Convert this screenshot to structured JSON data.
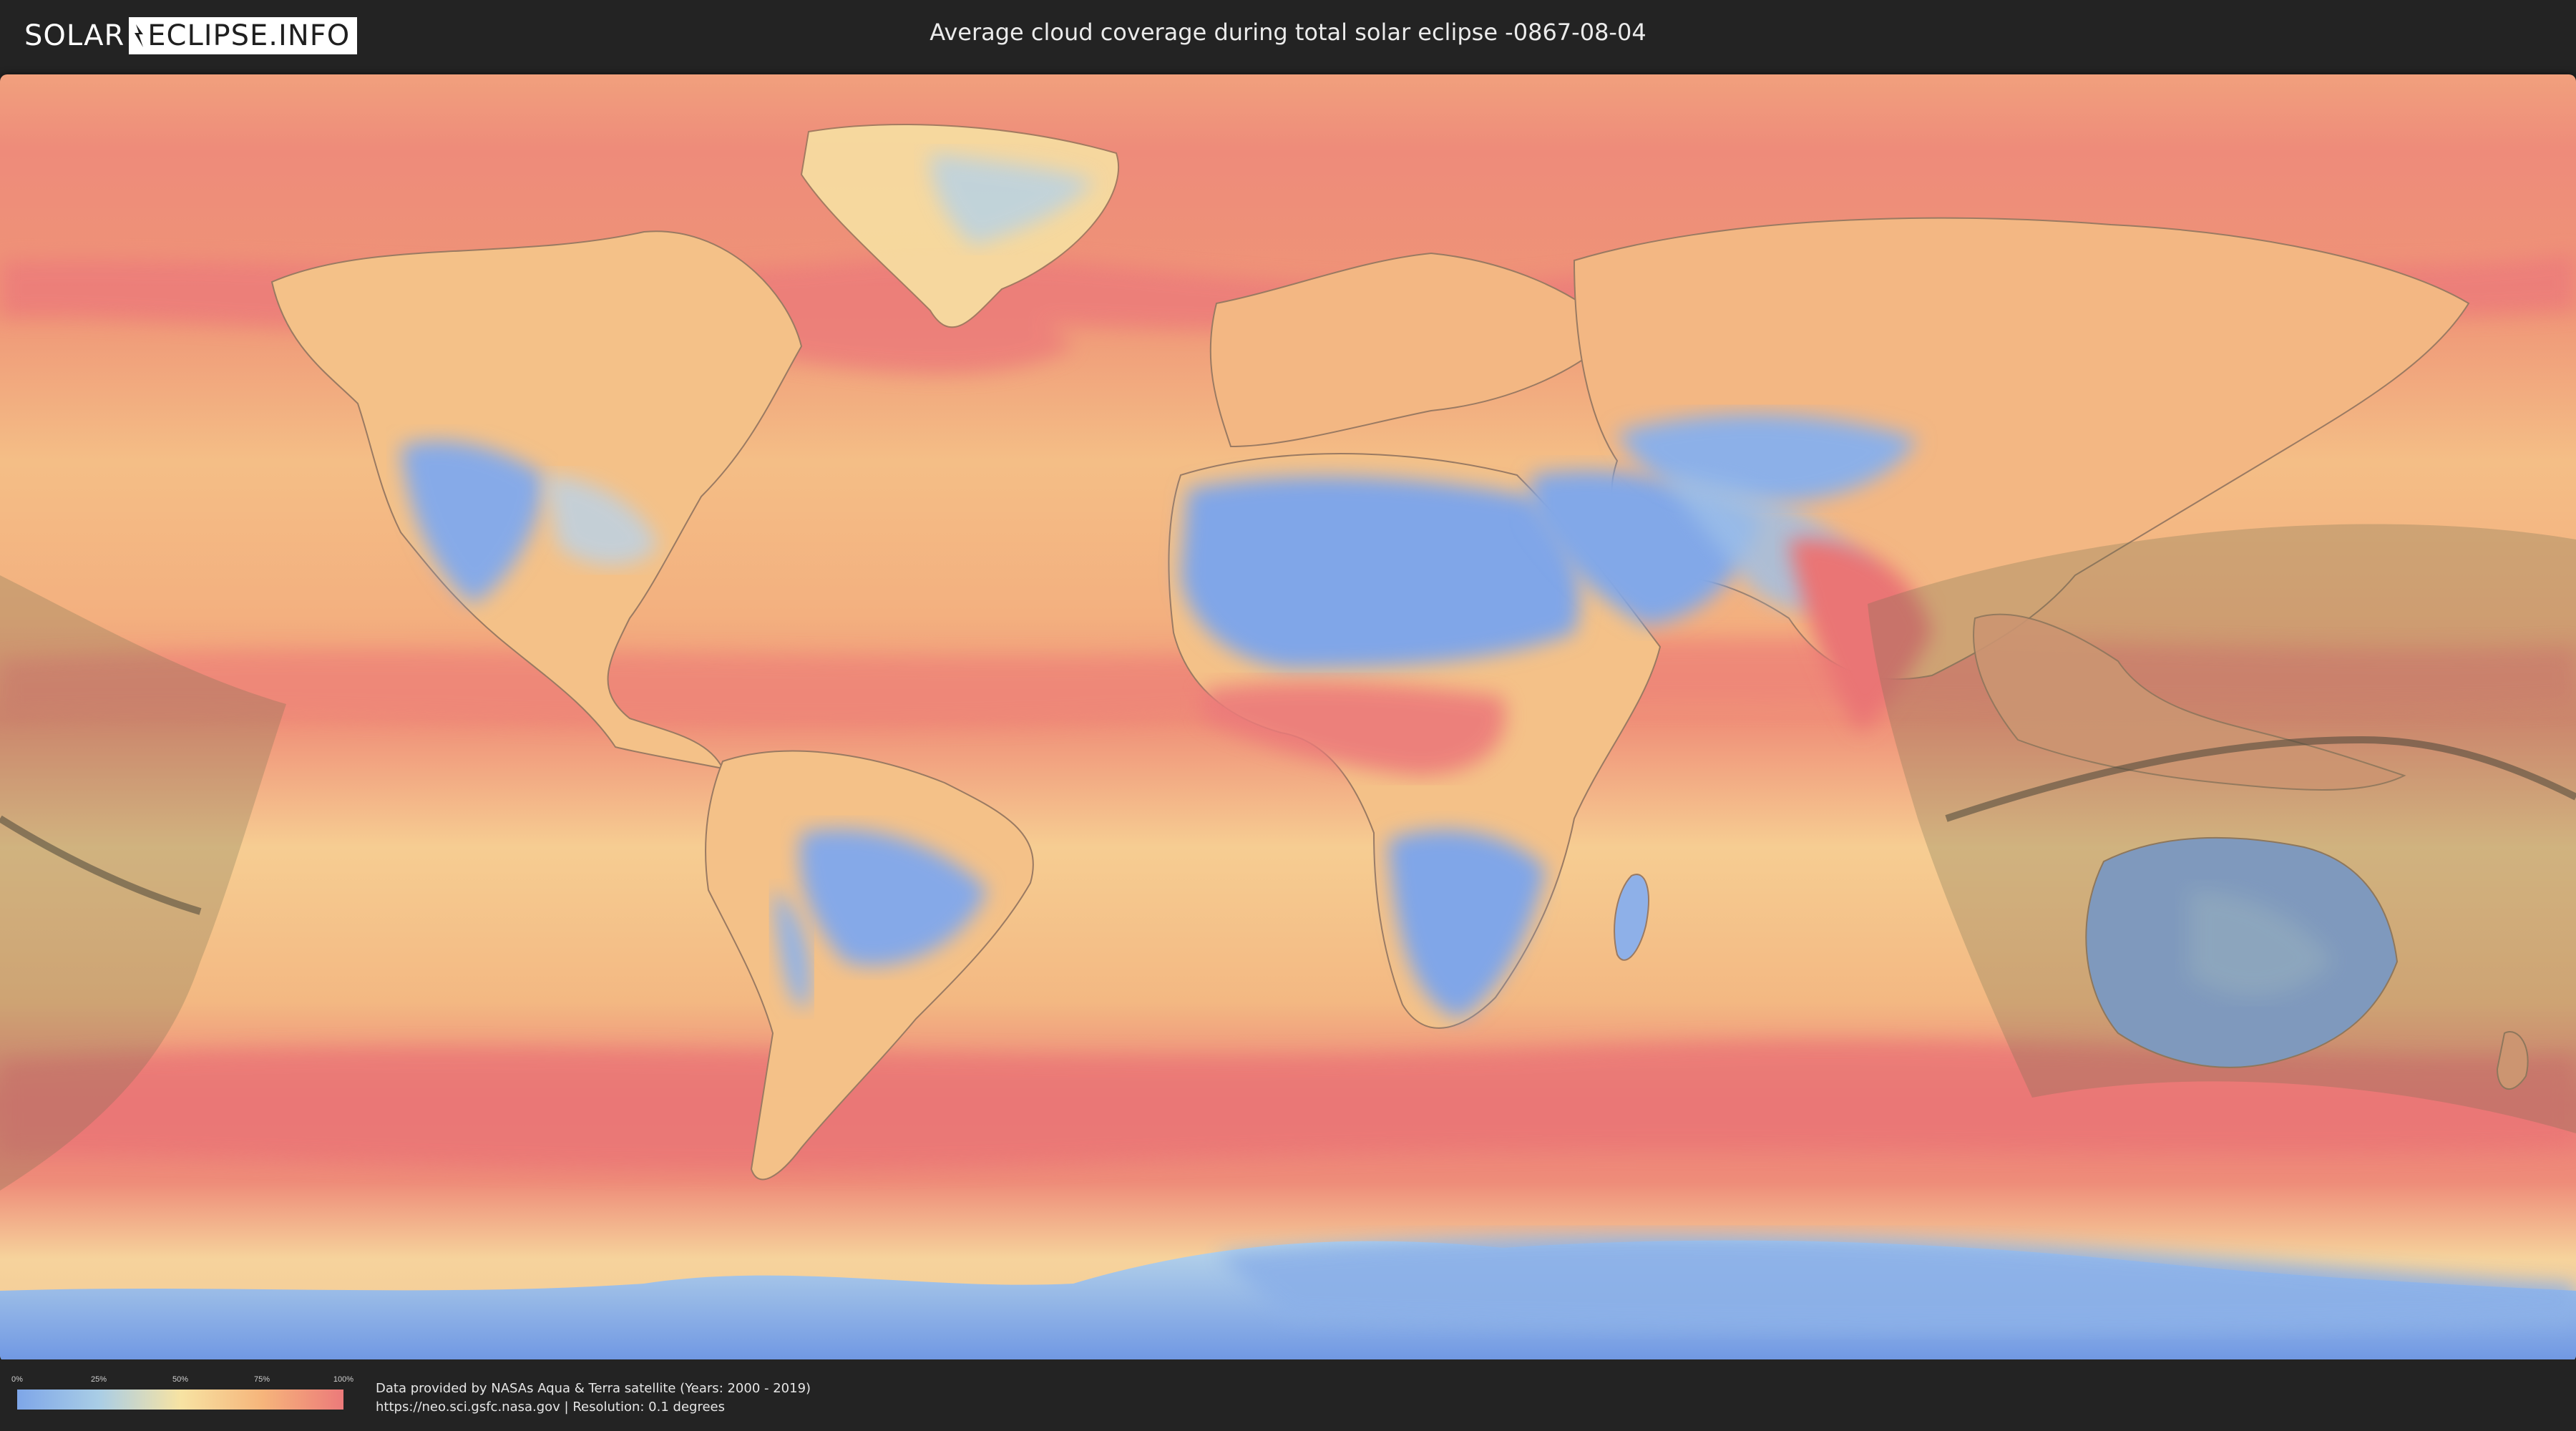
{
  "header": {
    "logo_solar": "SOLAR",
    "logo_eclipse": "ECLIPSE.INFO",
    "title": "Average cloud coverage during total solar eclipse -0867-08-04"
  },
  "legend": {
    "ticks": [
      "0%",
      "25%",
      "50%",
      "75%",
      "100%"
    ],
    "colors": [
      "#7ea6e8",
      "#a9cde6",
      "#f7e3a3",
      "#f6b57b",
      "#ec7a7a"
    ]
  },
  "footer": {
    "credit_line1": "Data provided by NASAs Aqua & Terra satellite (Years: 2000 - 2019)",
    "credit_line2": "https://neo.sci.gsfc.nasa.gov | Resolution: 0.1 degrees"
  },
  "map": {
    "ocean_color": "#f2a57c",
    "cloudy_color": "#ec7a7a",
    "clear_color": "#7ea6e8",
    "eclipse_shadow_color": "#6e6e50"
  }
}
